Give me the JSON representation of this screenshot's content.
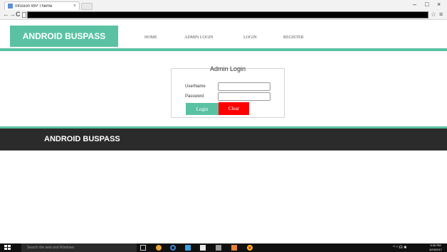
{
  "browser": {
    "tab_title": "Infusion WP Theme",
    "tab_close": "×",
    "window_controls": {
      "minimize": "–",
      "maximize": "□",
      "close": "×"
    },
    "nav": {
      "back": "←",
      "forward": "→",
      "reload": "C"
    },
    "star": "☆",
    "menu": "≡"
  },
  "header": {
    "brand": "ANDROID BUSPASS",
    "nav": [
      {
        "label": "HOME"
      },
      {
        "label": "ADMIN LOGIN"
      },
      {
        "label": "LOGIN"
      },
      {
        "label": "REGISTER"
      }
    ]
  },
  "login_form": {
    "title": "Admin Login",
    "username_label": "UserName",
    "username_value": "",
    "password_label": "Password",
    "password_value": "",
    "login_button": "Login",
    "clear_button": "Clear"
  },
  "footer": {
    "brand": "ANDROID BUSPASS"
  },
  "taskbar": {
    "search_placeholder": "Search the web and Windows",
    "tray_icons": "^ ⁿ ☊ ■",
    "time": "5:30 PM",
    "date": "4/23/2017"
  },
  "colors": {
    "accent": "#5ac2a2",
    "clear_button": "#ff0000",
    "footer_bg": "#2b2b2b"
  }
}
